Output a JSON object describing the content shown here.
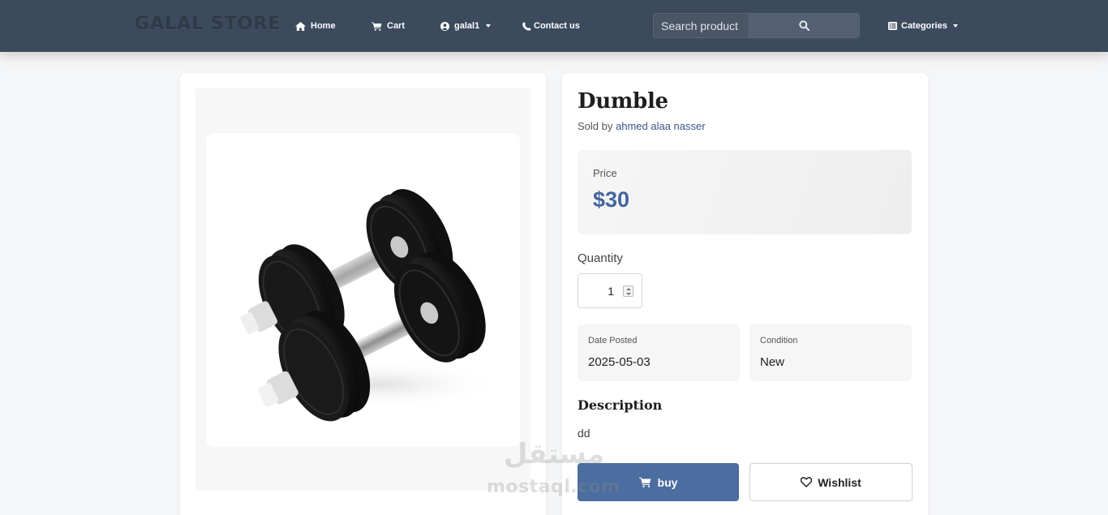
{
  "navbar": {
    "brand": "GALAL STORE",
    "home_label": "Home",
    "cart_label": "Cart",
    "user_label": "galal1",
    "contact_label": "Contact us",
    "search_placeholder": "Search product",
    "categories_label": "Categories",
    "icons": [
      "home-icon",
      "cart-icon",
      "user-circle-icon",
      "phone-icon",
      "search-icon",
      "list-icon"
    ]
  },
  "product": {
    "title": "Dumble",
    "sold_by_prefix": "Sold by",
    "seller": "ahmed alaa nasser",
    "price_label": "Price",
    "price": "$30",
    "quantity_label": "Quantity",
    "quantity": "1",
    "date_posted_label": "Date Posted",
    "date_posted": "2025-05-03",
    "condition_label": "Condition",
    "condition": "New",
    "description_label": "Description",
    "description": "dd",
    "buy_label": "buy",
    "wishlist_label": "Wishlist",
    "image_alt": "dumbbells"
  },
  "watermark": {
    "arabic": "مستقل",
    "latin": "mostaql.com"
  },
  "colors": {
    "navbar_bg": "#3b4a5d",
    "accent": "#43659e",
    "buy_button": "#4b6d9f",
    "page_bg": "#f5f6f7"
  }
}
